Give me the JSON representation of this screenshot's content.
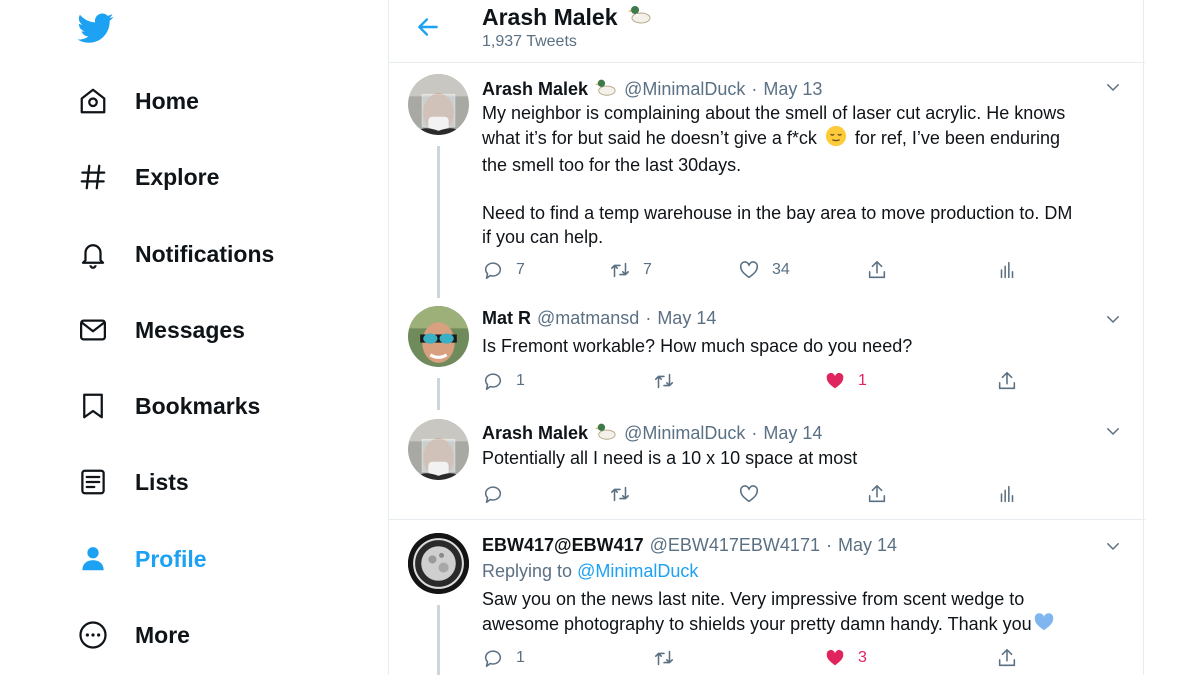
{
  "sidebar": {
    "items": [
      {
        "label": "Home",
        "icon": "home-icon"
      },
      {
        "label": "Explore",
        "icon": "hashtag-icon"
      },
      {
        "label": "Notifications",
        "icon": "bell-icon"
      },
      {
        "label": "Messages",
        "icon": "envelope-icon"
      },
      {
        "label": "Bookmarks",
        "icon": "bookmark-icon"
      },
      {
        "label": "Lists",
        "icon": "list-icon"
      },
      {
        "label": "Profile",
        "icon": "person-icon",
        "active": true
      },
      {
        "label": "More",
        "icon": "more-circle-icon"
      }
    ]
  },
  "header": {
    "title": "Arash Malek",
    "subtitle": "1,937 Tweets"
  },
  "tweets": [
    {
      "name": "Arash Malek",
      "handle": "@MinimalDuck",
      "date": "May 13",
      "lines": [
        "My neighbor is complaining about the smell of laser cut acrylic. He knows",
        "what it’s for but said he doesn’t give a f*ck",
        "for ref, I’ve been enduring",
        "the smell too for the last 30days.",
        "Need to find a temp warehouse in the bay area to move production to. DM",
        "if you can help."
      ],
      "replies": "7",
      "retweets": "7",
      "likes": "34"
    },
    {
      "name": "Mat R",
      "handle": "@matmansd",
      "date": "May 14",
      "text": "Is Fremont workable?  How much space do you need?",
      "replies": "1",
      "likes": "1"
    },
    {
      "name": "Arash Malek",
      "handle": "@MinimalDuck",
      "date": "May 14",
      "text": "Potentially all I need is a 10 x 10 space at most"
    },
    {
      "name": "EBW417@EBW417",
      "handle": "@EBW417EBW4171",
      "date": "May 14",
      "replying_label": "Replying to",
      "replying_to": "@MinimalDuck",
      "lines": [
        "Saw you on the news last nite. Very impressive from scent wedge to",
        "awesome photography to shields your pretty damn handy. Thank you"
      ],
      "replies": "1",
      "likes": "3"
    }
  ],
  "colors": {
    "accent": "#1da1f2",
    "like": "#e0245e",
    "muted": "#5b7083",
    "border": "#e6ecf0"
  }
}
